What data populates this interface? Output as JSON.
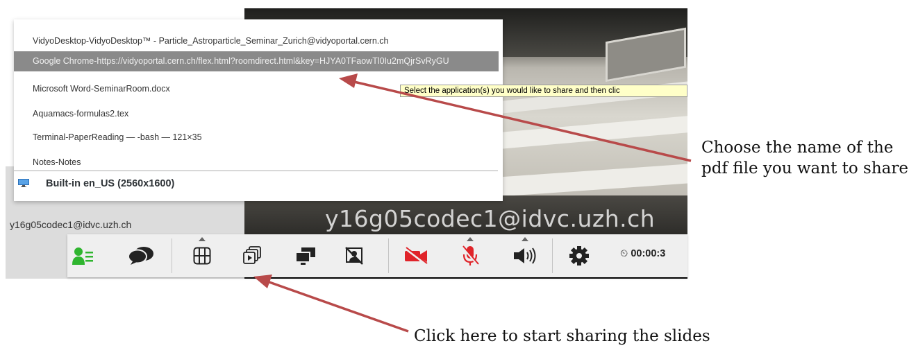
{
  "video": {
    "remote_participant": "y16g05codec1@idvc.uzh.ch"
  },
  "self_view": {
    "participant": "y16g05codec1@idvc.uzh.ch"
  },
  "app_list": {
    "items": [
      {
        "label": "VidyoDesktop-VidyoDesktop™ - Particle_Astroparticle_Seminar_Zurich@vidyoportal.cern.ch",
        "selected": false
      },
      {
        "label": "Google Chrome-https://vidyoportal.cern.ch/flex.html?roomdirect.html&key=HJYA0TFaowTl0Iu2mQjrSvRyGU",
        "selected": true
      },
      {
        "label": "Microsoft Word-SeminarRoom.docx",
        "selected": false
      },
      {
        "label": "Aquamacs-formulas2.tex",
        "selected": false
      },
      {
        "label": "Terminal-PaperReading — -bash — 121×35",
        "selected": false
      },
      {
        "label": "Notes-Notes",
        "selected": false
      }
    ],
    "display": {
      "label": "Built-in en_US (2560x1600)",
      "icon": "monitor-icon"
    }
  },
  "tooltip": {
    "text": "Select the application(s) you would like to share and then clic"
  },
  "toolbar": {
    "buttons": [
      {
        "name": "participants-button",
        "icon": "participants-icon",
        "color": "#2fb52f"
      },
      {
        "name": "chat-button",
        "icon": "chat-bubbles-icon"
      },
      {
        "name": "layout-button",
        "icon": "grid-layout-icon"
      },
      {
        "name": "share-button",
        "icon": "share-windows-icon"
      },
      {
        "name": "self-view-button",
        "icon": "screens-icon"
      },
      {
        "name": "privacy-button",
        "icon": "privacy-off-icon"
      },
      {
        "name": "camera-button",
        "icon": "camera-off-icon",
        "color": "#e0242a"
      },
      {
        "name": "microphone-button",
        "icon": "microphone-off-icon",
        "color": "#e0242a"
      },
      {
        "name": "speaker-button",
        "icon": "speaker-icon"
      },
      {
        "name": "settings-button",
        "icon": "gear-icon"
      }
    ],
    "timer": "00:00:3"
  },
  "annotations": {
    "choose": "Choose the name of the pdf file you want to share",
    "click": "Click here to start sharing the slides"
  }
}
